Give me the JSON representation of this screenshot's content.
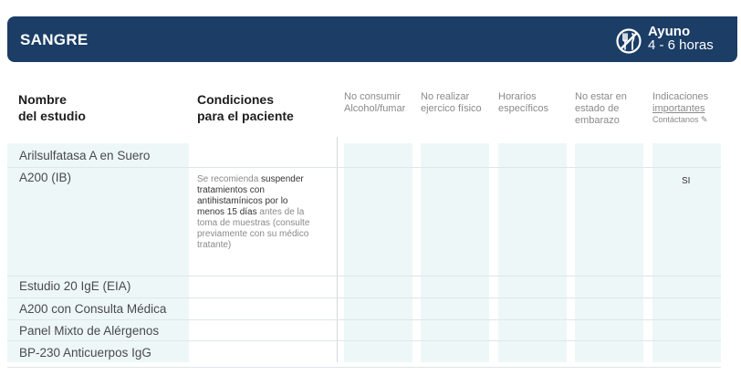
{
  "banner": {
    "title": "SANGRE",
    "fasting_title": "Ayuno",
    "fasting_hours": "4 - 6 horas",
    "fasting_icon": "no-food-icon",
    "color": "#1b3d66"
  },
  "headers": {
    "study_line1": "Nombre",
    "study_line2": "del estudio",
    "conditions_line1": "Condiciones",
    "conditions_line2": "para el paciente",
    "col1_line1": "No consumir",
    "col1_line2": "Alcohol/fumar",
    "col2_line1": "No realizar",
    "col2_line2": "ejercico físico",
    "col3_line1": "Horarios",
    "col3_line2": "específicos",
    "col4_line1": "No estar en",
    "col4_line2": "estado de",
    "col4_line3": "embarazo",
    "col5_line1": "Indicaciones",
    "col5_line2": "importantes",
    "col5_note": "Contáctanos ✎"
  },
  "rows": [
    {
      "name": "Arilsulfatasa A en Suero"
    },
    {
      "name": "A200 (IB)",
      "condition": {
        "part1": "Se recomienda ",
        "part2": "suspender tratamientos con antihistamínicos por lo menos 15 días",
        "part3": " antes de la toma de muestras (consulte previamente con su médico tratante)"
      },
      "indicaciones": "SI"
    },
    {
      "name": "Estudio 20 IgE (EIA)"
    },
    {
      "name": "A200 con Consulta Médica"
    },
    {
      "name": "Panel Mixto de Alérgenos"
    },
    {
      "name": "BP-230  Anticuerpos IgG"
    }
  ],
  "colors": {
    "column_fill": "#eef7f8",
    "header_text": "#1e1e1e",
    "muted_text": "#8a8a8a"
  }
}
